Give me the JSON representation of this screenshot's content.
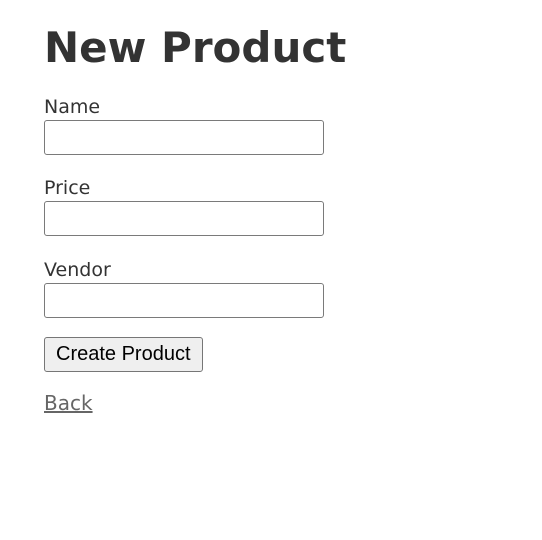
{
  "page": {
    "title": "New Product"
  },
  "form": {
    "fields": [
      {
        "label": "Name",
        "value": "",
        "placeholder": ""
      },
      {
        "label": "Price",
        "value": "",
        "placeholder": ""
      },
      {
        "label": "Vendor",
        "value": "",
        "placeholder": ""
      }
    ],
    "submit_label": "Create Product"
  },
  "nav": {
    "back_label": "Back"
  },
  "colors": {
    "text": "#333333",
    "link": "#666666",
    "button_bg": "#efefef",
    "input_border": "#7a7a7a"
  }
}
